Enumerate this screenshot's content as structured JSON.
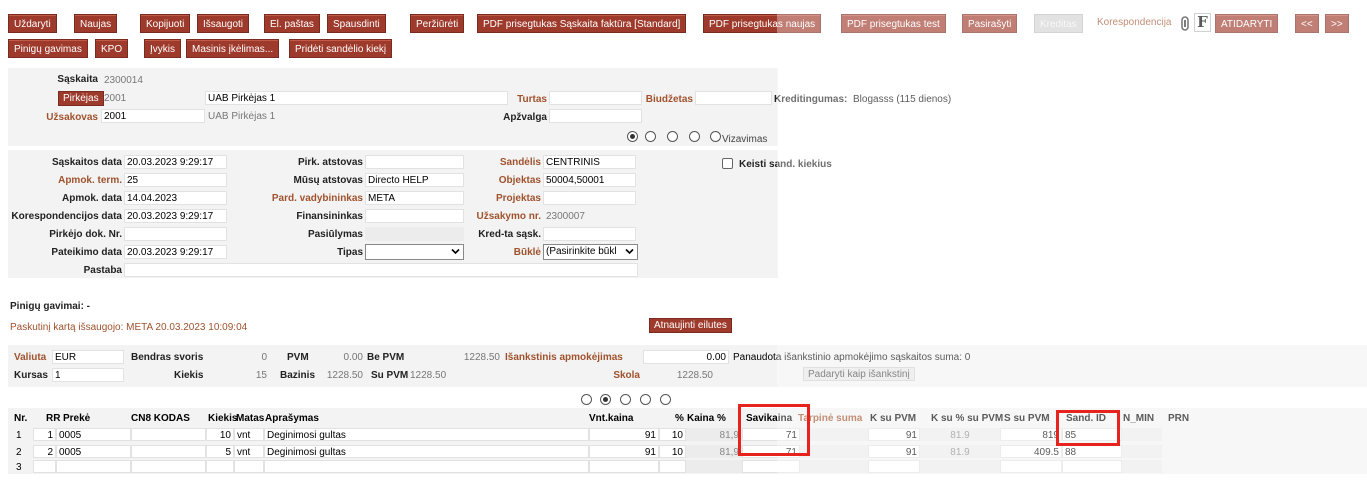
{
  "toolbar": {
    "row1": [
      "Uždaryti",
      "Naujas",
      "Kopijuoti",
      "Išsaugoti",
      "El. paštas",
      "Spausdinti",
      "Peržiūrėti",
      "PDF prisegtukas Sąskaita faktūra [Standard]",
      "PDF prisegtukas naujas",
      "PDF prisegtukas test",
      "Pasirašyti",
      "Kreditas"
    ],
    "korespondencija": "Korespondencija",
    "f_letter": "F",
    "atidaryti": "ATIDARYTI",
    "prev": "<<",
    "next": ">>",
    "row2": [
      "Pinigų gavimas",
      "KPO",
      "Įvykis",
      "Masinis įkėlimas...",
      "Pridėti sandėlio kiekį"
    ]
  },
  "header": {
    "saskaita_label": "Sąskaita",
    "saskaita_value": "2300014",
    "pirkejas_label": "Pirkėjas",
    "pirkejas_code": "2001",
    "pirkejas_name": "UAB Pirkėjas 1",
    "uzsakovas_label": "Užsakovas",
    "uzsakovas_code": "2001",
    "uzsakovas_name": "UAB Pirkėjas 1",
    "turtas_label": "Turtas",
    "biudzetas_label": "Biudžetas",
    "apzvalga_label": "Apžvalga",
    "kreditingumas_label": "Kreditingumas:",
    "kreditingumas_value": "Blogasss (115 dienos)",
    "vizavimas_label": "Vizavimas"
  },
  "form": {
    "saskaitos_data_label": "Sąskaitos data",
    "saskaitos_data": "20.03.2023 9:29:17",
    "apmok_term_label": "Apmok. term.",
    "apmok_term": "25",
    "apmok_data_label": "Apmok. data",
    "apmok_data": "14.04.2023",
    "korespondencijos_data_label": "Korespondencijos data",
    "korespondencijos_data": "20.03.2023 9:29:17",
    "pirkejo_dok_label": "Pirkėjo dok. Nr.",
    "pateikimo_data_label": "Pateikimo data",
    "pateikimo_data": "20.03.2023 9:29:17",
    "pastaba_label": "Pastaba",
    "pirk_atstovas_label": "Pirk. atstovas",
    "musu_atstovas_label": "Mūsų atstovas",
    "musu_atstovas": "Directo HELP",
    "pard_vadybininkas_label": "Pard. vadybininkas",
    "pard_vadybininkas": "META",
    "finansininkas_label": "Finansininkas",
    "pasiulymas_label": "Pasiūlymas",
    "tipas_label": "Tipas",
    "sandelis_label": "Sandėlis",
    "sandelis": "CENTRINIS",
    "objektas_label": "Objektas",
    "objektas": "50004,50001",
    "projektas_label": "Projektas",
    "uzsakymo_nr_label": "Užsakymo nr.",
    "uzsakymo_nr": "2300007",
    "kred_ta_label": "Kred-ta sąsk.",
    "bukle_label": "Būklė",
    "bukle_value": "(Pasirinkite būkl",
    "keisti_sand_label": "Keisti sand. kiekius"
  },
  "info": {
    "pinigu_gavimai": "Pinigų gavimai: -",
    "paskutini": "Paskutinį kartą išsaugojo: META 20.03.2023 10:09:04",
    "atnaujinti": "Atnaujinti eilutes"
  },
  "totals": {
    "valiuta_label": "Valiuta",
    "valiuta": "EUR",
    "kursas_label": "Kursas",
    "kursas": "1",
    "bendras_svoris_label": "Bendras svoris",
    "bendras_svoris": "0",
    "kiekis_label": "Kiekis",
    "kiekis": "15",
    "pvm_label": "PVM",
    "pvm": "0.00",
    "be_pvm_label": "Be PVM",
    "be_pvm": "1228.50",
    "bazinis_label": "Bazinis",
    "bazinis": "1228.50",
    "su_pvm_label": "Su PVM",
    "su_pvm": "1228.50",
    "isankstinis_label": "Išankstinis apmokėjimas",
    "isankstinis": "0.00",
    "skola_label": "Skola",
    "skola": "1228.50",
    "panaudota": "Panaudota išankstinio apmokėjimo sąskaitos suma: 0",
    "padaryti": "Padaryti kaip išankstinį"
  },
  "table": {
    "headers": [
      "Nr.",
      "RR",
      "Prekė",
      "CN8 KODAS",
      "Kiekis",
      "Matas",
      "Aprašymas",
      "Vnt.kaina",
      "%",
      "Kaina %",
      "Savikaina",
      "Tarpinė suma",
      "K su PVM",
      "K su % su PVM",
      "S su PVM",
      "Sand. ID",
      "N_MIN",
      "PRN"
    ],
    "rows": [
      {
        "nr": "1",
        "rr": "1",
        "preke": "0005",
        "kiekis": "10",
        "matas": "vnt",
        "aprasymas": "Deginimosi gultas",
        "vnt_kaina": "91",
        "proc": "10",
        "kaina_proc": "81,9",
        "savikaina": "71",
        "k_su_pvm": "91",
        "k_su_proc": "81.9",
        "s_su_pvm": "819",
        "sand_id": "85"
      },
      {
        "nr": "2",
        "rr": "2",
        "preke": "0005",
        "kiekis": "5",
        "matas": "vnt",
        "aprasymas": "Deginimosi gultas",
        "vnt_kaina": "91",
        "proc": "10",
        "kaina_proc": "81,9",
        "savikaina": "71",
        "k_su_pvm": "91",
        "k_su_proc": "81.9",
        "s_su_pvm": "409.5",
        "sand_id": "88"
      },
      {
        "nr": "3",
        "rr": "",
        "preke": "",
        "kiekis": "",
        "matas": "",
        "aprasymas": "",
        "vnt_kaina": "",
        "proc": "",
        "kaina_proc": "",
        "savikaina": "",
        "k_su_pvm": "",
        "k_su_proc": "",
        "s_su_pvm": "",
        "sand_id": ""
      }
    ]
  },
  "icons": {
    "attachment": "paperclip-icon",
    "dropdown": "chevron-down-icon"
  },
  "colors": {
    "toolbar": "#9e3a2c",
    "highlight": "#e8231e",
    "label_red": "#a0522d"
  }
}
